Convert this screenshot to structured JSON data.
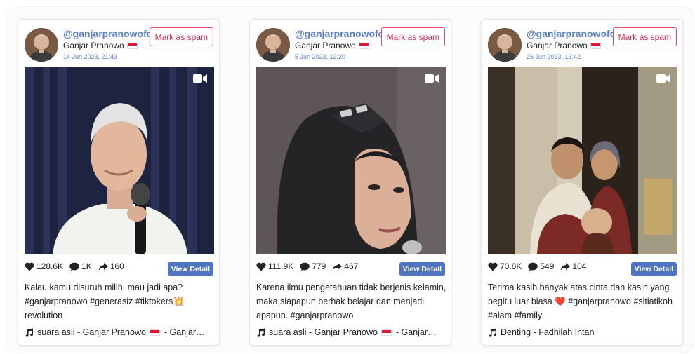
{
  "posts": [
    {
      "handle": "@ganjarpranowofc",
      "name": "Ganjar Pranowo",
      "date": "14 Jun 2023, 21:43",
      "spam_label": "Mark as spam",
      "likes": "128.6K",
      "comments": "1K",
      "shares": "160",
      "view_label": "View Detail",
      "caption": "Kalau kamu disuruh milih, mau jadi apa? #ganjarpranowo #generasiz #tiktokers💥 revolution",
      "music_a": "suara asli - Ganjar Pranowo",
      "music_b": "- Ganjar…"
    },
    {
      "handle": "@ganjarpranowofc",
      "name": "Ganjar Pranowo",
      "date": "5 Jun 2023, 12:20",
      "spam_label": "Mark as spam",
      "likes": "111.9K",
      "comments": "779",
      "shares": "467",
      "view_label": "View Detail",
      "caption": "Karena ilmu pengetahuan tidak berjenis kelamin, maka siapapun berhak belajar dan menjadi apapun. #ganjarpranowo",
      "music_a": "suara asli - Ganjar Pranowo",
      "music_b": "- Ganjar…"
    },
    {
      "handle": "@ganjarpranowofc",
      "name": "Ganjar Pranowo",
      "date": "26 Jun 2023, 13:42",
      "spam_label": "Mark as spam",
      "likes": "70.8K",
      "comments": "549",
      "shares": "104",
      "view_label": "View Detail",
      "caption": "Terima kasih banyak atas cinta dan kasih yang begitu luar biasa ❤️ #ganjarpranowo #sitiatikoh #alam #family",
      "music_a": "Denting - Fadhilah Intan",
      "music_b": ""
    }
  ],
  "icons": {
    "like": "heart-icon",
    "comment": "comment-icon",
    "share": "share-icon",
    "music": "music-note-icon",
    "video": "video-camera-icon",
    "flag": "indonesia-flag-icon"
  },
  "colors": {
    "handle": "#5b7ed2",
    "spam": "#d62d4c",
    "view_button": "#4f75c1"
  }
}
